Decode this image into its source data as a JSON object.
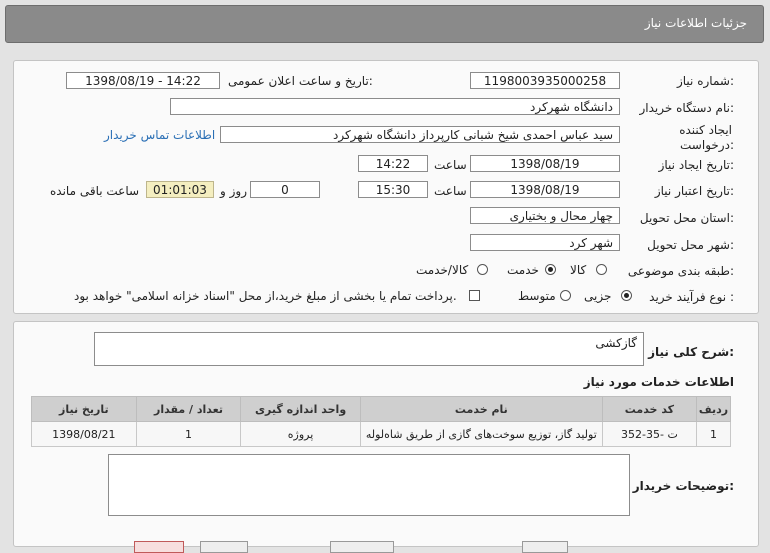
{
  "header": {
    "title": "جزئیات اطلاعات نیاز"
  },
  "form": {
    "need_number_label": "شماره نیاز:",
    "need_number": "1198003935000258",
    "announce_label": "تاریخ و ساعت اعلان عمومی:",
    "announce_value": "1398/08/19 - 14:22",
    "buyer_org_label": "نام دستگاه خریدار:",
    "buyer_org": "دانشگاه شهرکرد",
    "creator_label_1": "ایجاد کننده",
    "creator_label_2": "درخواست:",
    "creator": "سید عباس احمدی شیخ شبانی کارپرداز دانشگاه شهرکرد",
    "contact_link": "اطلاعات تماس خریدار",
    "created_date_label": "تاریخ ایجاد نیاز:",
    "created_date": "1398/08/19",
    "time_label": "ساعت",
    "created_time": "14:22",
    "validity_label": "تاریخ اعتبار نیاز:",
    "validity_date": "1398/08/19",
    "validity_time": "15:30",
    "days_value": "0",
    "days_label": "روز و",
    "remaining_time": "01:01:03",
    "remaining_label": "ساعت باقی مانده",
    "province_label": "استان محل تحویل:",
    "province": "چهار محال و بختیاری",
    "city_label": "شهر محل تحویل:",
    "city": "شهر کرد",
    "category_label": "طبقه بندی موضوعی:",
    "category_options": [
      "کالا",
      "خدمت",
      "کالا/خدمت"
    ],
    "category_selected": "خدمت",
    "process_label": "نوع فرآیند خرید :",
    "process_options": [
      "جزیی",
      "متوسط"
    ],
    "process_selected": "جزیی",
    "payment_note": "پرداخت تمام یا بخشی از مبلغ خرید،از محل \"اسناد خزانه اسلامی\" خواهد بود."
  },
  "details": {
    "summary_label": "شرح کلی نیاز:",
    "summary": "گازکشی",
    "services_title": "اطلاعات خدمات مورد نیاز",
    "columns": [
      "ردیف",
      "کد خدمت",
      "نام خدمت",
      "واحد اندازه گیری",
      "تعداد / مقدار",
      "تاریخ نیاز"
    ],
    "rows": [
      {
        "index": "1",
        "code": "ت -35-352",
        "name": "تولید گاز، توزیع سوخت‌های گازی از طریق شاه‌لوله",
        "unit": "پروژه",
        "qty": "1",
        "date": "1398/08/21"
      }
    ],
    "buyer_notes_label": "توضیحات خریدار:",
    "buyer_notes": ""
  },
  "colors": {
    "title_bar": "#8a8a8a",
    "link": "#2a6fb5",
    "timer_bg": "#f4eec0"
  }
}
